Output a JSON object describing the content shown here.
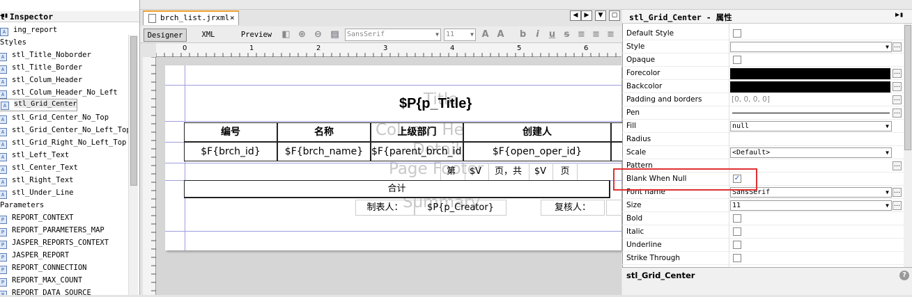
{
  "left_panel": {
    "title": "t Inspector",
    "items": [
      {
        "label": "ing_report",
        "icon": "report-icon",
        "indent": 0
      },
      {
        "label": "Styles",
        "icon": "",
        "indent": 0
      },
      {
        "label": "stl_Title_Noborder",
        "icon": "style-icon",
        "indent": 1
      },
      {
        "label": "stl_Title_Border",
        "icon": "style-icon",
        "indent": 1
      },
      {
        "label": "stl_Colum_Header",
        "icon": "style-icon",
        "indent": 1
      },
      {
        "label": "stl_Colum_Header_No_Left",
        "icon": "style-icon",
        "indent": 1
      },
      {
        "label": "stl_Grid_Center",
        "icon": "style-icon",
        "indent": 1,
        "selected": true
      },
      {
        "label": "stl_Grid_Center_No_Top",
        "icon": "style-icon",
        "indent": 1
      },
      {
        "label": "stl_Grid_Center_No_Left_Top",
        "icon": "style-icon",
        "indent": 1
      },
      {
        "label": "stl_Grid_Right_No_Left_Top",
        "icon": "style-icon",
        "indent": 1
      },
      {
        "label": "stl_Left_Text",
        "icon": "style-icon",
        "indent": 1
      },
      {
        "label": "stl_Center_Text",
        "icon": "style-icon",
        "indent": 1
      },
      {
        "label": "stl_Right_Text",
        "icon": "style-icon",
        "indent": 1
      },
      {
        "label": "stl_Under_Line",
        "icon": "style-icon",
        "indent": 1
      },
      {
        "label": "Parameters",
        "icon": "",
        "indent": 0
      },
      {
        "label": "REPORT_CONTEXT",
        "icon": "parameter-icon",
        "indent": 1
      },
      {
        "label": "REPORT_PARAMETERS_MAP",
        "icon": "parameter-icon",
        "indent": 1
      },
      {
        "label": "JASPER_REPORTS_CONTEXT",
        "icon": "parameter-icon",
        "indent": 1
      },
      {
        "label": "JASPER_REPORT",
        "icon": "parameter-icon",
        "indent": 1
      },
      {
        "label": "REPORT_CONNECTION",
        "icon": "parameter-icon",
        "indent": 1
      },
      {
        "label": "REPORT_MAX_COUNT",
        "icon": "parameter-icon",
        "indent": 1
      },
      {
        "label": "REPORT_DATA_SOURCE",
        "icon": "parameter-icon",
        "indent": 1
      }
    ]
  },
  "editor": {
    "tab_label": "brch_list.jrxml",
    "close_glyph": "×",
    "views": [
      "Designer",
      "XML",
      "Preview"
    ],
    "font_combo": "SansSerif",
    "size_combo": "11",
    "ruler_numbers": [
      "0",
      "1",
      "2",
      "3",
      "4",
      "5",
      "6"
    ],
    "report": {
      "title_field": "$P{p_Title}",
      "headers": [
        "编号",
        "名称",
        "上级部门",
        "创建人"
      ],
      "fields": [
        "$F{brch_id}",
        "$F{brch_name}",
        "$F{parent_brch_id}",
        "$F{open_oper_id}"
      ],
      "page_footer": [
        "第",
        "$V",
        "页，共",
        "$V",
        "页"
      ],
      "summary_label": "合计",
      "creator_label": "制表人：",
      "creator_field": "$P{p_Creator}",
      "reviewer_label": "复核人：",
      "band_ghosts": [
        "Title",
        "Column Header",
        "Detail",
        "Page Footer",
        "Summary"
      ]
    }
  },
  "properties": {
    "title": "stl_Grid_Center - 属性",
    "rows": [
      {
        "name": "Default Style",
        "type": "checkbox",
        "checked": false
      },
      {
        "name": "Style",
        "type": "select",
        "value": ""
      },
      {
        "name": "Opaque",
        "type": "checkbox",
        "checked": false
      },
      {
        "name": "Forecolor",
        "type": "color",
        "color": "#000000"
      },
      {
        "name": "Backcolor",
        "type": "color",
        "color": "#000000"
      },
      {
        "name": "Padding and borders",
        "type": "text",
        "value": "[0, 0, 0, 0]"
      },
      {
        "name": "Pen",
        "type": "line"
      },
      {
        "name": "Fill",
        "type": "select",
        "value": "null"
      },
      {
        "name": "Radius",
        "type": "empty"
      },
      {
        "name": "Scale",
        "type": "select",
        "value": "<Default>"
      },
      {
        "name": "Pattern",
        "type": "empty-dots"
      },
      {
        "name": "Blank When Null",
        "type": "checkbox",
        "checked": true
      },
      {
        "name": "Font name",
        "type": "select",
        "value": "SansSerif"
      },
      {
        "name": "Size",
        "type": "select",
        "value": "11"
      },
      {
        "name": "Bold",
        "type": "checkbox",
        "checked": false
      },
      {
        "name": "Italic",
        "type": "checkbox",
        "checked": false
      },
      {
        "name": "Underline",
        "type": "checkbox",
        "checked": false
      },
      {
        "name": "Strike Through",
        "type": "checkbox",
        "checked": false
      }
    ],
    "description": "stl_Grid_Center",
    "highlight_color": "#e03030"
  }
}
